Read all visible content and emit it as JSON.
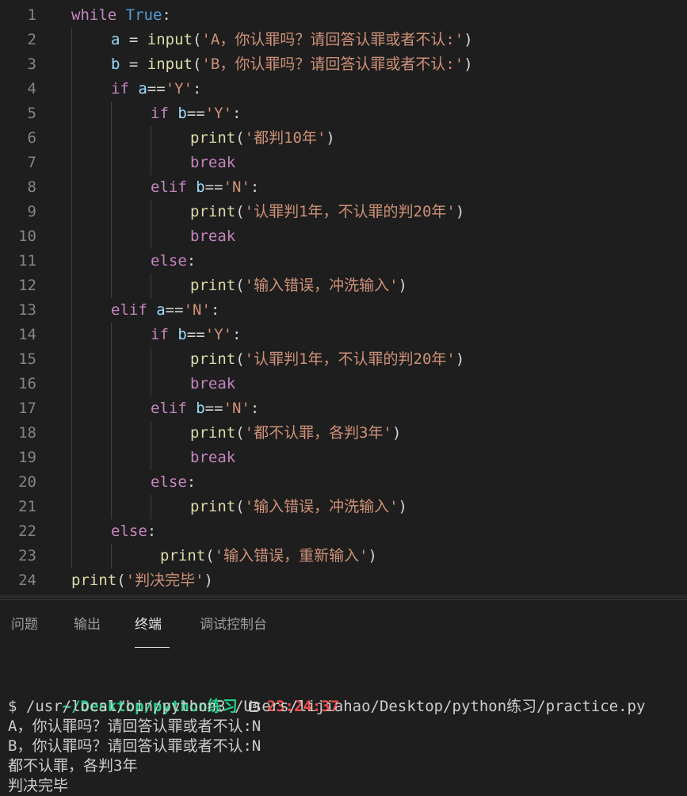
{
  "editor": {
    "lines": [
      {
        "n": "1",
        "tokens": [
          [
            "kw",
            "while"
          ],
          [
            "punc",
            " "
          ],
          [
            "const",
            "True"
          ],
          [
            "punc",
            ":"
          ]
        ]
      },
      {
        "n": "2",
        "tokens": [
          [
            "var",
            "a"
          ],
          [
            "punc",
            " = "
          ],
          [
            "fn",
            "input"
          ],
          [
            "punc",
            "("
          ],
          [
            "str",
            "'A，你认罪吗？请回答认罪或者不认:'"
          ],
          [
            "punc",
            ")"
          ]
        ]
      },
      {
        "n": "3",
        "tokens": [
          [
            "var",
            "b"
          ],
          [
            "punc",
            " = "
          ],
          [
            "fn",
            "input"
          ],
          [
            "punc",
            "("
          ],
          [
            "str",
            "'B，你认罪吗？请回答认罪或者不认:'"
          ],
          [
            "punc",
            ")"
          ]
        ]
      },
      {
        "n": "4",
        "tokens": [
          [
            "kw",
            "if"
          ],
          [
            "punc",
            " "
          ],
          [
            "var",
            "a"
          ],
          [
            "punc",
            "=="
          ],
          [
            "str",
            "'Y'"
          ],
          [
            "punc",
            ":"
          ]
        ]
      },
      {
        "n": "5",
        "tokens": [
          [
            "kw",
            "if"
          ],
          [
            "punc",
            " "
          ],
          [
            "var",
            "b"
          ],
          [
            "punc",
            "=="
          ],
          [
            "str",
            "'Y'"
          ],
          [
            "punc",
            ":"
          ]
        ]
      },
      {
        "n": "6",
        "tokens": [
          [
            "fn",
            "print"
          ],
          [
            "punc",
            "("
          ],
          [
            "str",
            "'都判10年'"
          ],
          [
            "punc",
            ")"
          ]
        ]
      },
      {
        "n": "7",
        "tokens": [
          [
            "kw",
            "break"
          ]
        ]
      },
      {
        "n": "8",
        "tokens": [
          [
            "kw",
            "elif"
          ],
          [
            "punc",
            " "
          ],
          [
            "var",
            "b"
          ],
          [
            "punc",
            "=="
          ],
          [
            "str",
            "'N'"
          ],
          [
            "punc",
            ":"
          ]
        ]
      },
      {
        "n": "9",
        "tokens": [
          [
            "fn",
            "print"
          ],
          [
            "punc",
            "("
          ],
          [
            "str",
            "'认罪判1年，不认罪的判20年'"
          ],
          [
            "punc",
            ")"
          ]
        ]
      },
      {
        "n": "10",
        "tokens": [
          [
            "kw",
            "break"
          ]
        ]
      },
      {
        "n": "11",
        "tokens": [
          [
            "kw",
            "else"
          ],
          [
            "punc",
            ":"
          ]
        ]
      },
      {
        "n": "12",
        "tokens": [
          [
            "fn",
            "print"
          ],
          [
            "punc",
            "("
          ],
          [
            "str",
            "'输入错误，冲洗输入'"
          ],
          [
            "punc",
            ")"
          ]
        ]
      },
      {
        "n": "13",
        "tokens": [
          [
            "kw",
            "elif"
          ],
          [
            "punc",
            " "
          ],
          [
            "var",
            "a"
          ],
          [
            "punc",
            "=="
          ],
          [
            "str",
            "'N'"
          ],
          [
            "punc",
            ":"
          ]
        ]
      },
      {
        "n": "14",
        "tokens": [
          [
            "kw",
            "if"
          ],
          [
            "punc",
            " "
          ],
          [
            "var",
            "b"
          ],
          [
            "punc",
            "=="
          ],
          [
            "str",
            "'Y'"
          ],
          [
            "punc",
            ":"
          ]
        ]
      },
      {
        "n": "15",
        "tokens": [
          [
            "fn",
            "print"
          ],
          [
            "punc",
            "("
          ],
          [
            "str",
            "'认罪判1年，不认罪的判20年'"
          ],
          [
            "punc",
            ")"
          ]
        ]
      },
      {
        "n": "16",
        "tokens": [
          [
            "kw",
            "break"
          ]
        ]
      },
      {
        "n": "17",
        "tokens": [
          [
            "kw",
            "elif"
          ],
          [
            "punc",
            " "
          ],
          [
            "var",
            "b"
          ],
          [
            "punc",
            "=="
          ],
          [
            "str",
            "'N'"
          ],
          [
            "punc",
            ":"
          ]
        ]
      },
      {
        "n": "18",
        "tokens": [
          [
            "fn",
            "print"
          ],
          [
            "punc",
            "("
          ],
          [
            "str",
            "'都不认罪，各判3年'"
          ],
          [
            "punc",
            ")"
          ]
        ]
      },
      {
        "n": "19",
        "tokens": [
          [
            "kw",
            "break"
          ]
        ]
      },
      {
        "n": "20",
        "tokens": [
          [
            "kw",
            "else"
          ],
          [
            "punc",
            ":"
          ]
        ]
      },
      {
        "n": "21",
        "tokens": [
          [
            "fn",
            "print"
          ],
          [
            "punc",
            "("
          ],
          [
            "str",
            "'输入错误，冲洗输入'"
          ],
          [
            "punc",
            ")"
          ]
        ]
      },
      {
        "n": "22",
        "tokens": [
          [
            "kw",
            "else"
          ],
          [
            "punc",
            ":"
          ]
        ]
      },
      {
        "n": "23",
        "tokens": [
          [
            "fn",
            "print"
          ],
          [
            "punc",
            "("
          ],
          [
            "str",
            "'输入错误，重新输入'"
          ],
          [
            "punc",
            ")"
          ]
        ]
      },
      {
        "n": "24",
        "tokens": [
          [
            "fn",
            "print"
          ],
          [
            "punc",
            "("
          ],
          [
            "str",
            "'判决完毕'"
          ],
          [
            "punc",
            ")"
          ]
        ]
      }
    ]
  },
  "panel": {
    "tabs": [
      {
        "label": "问题",
        "active": false
      },
      {
        "label": "输出",
        "active": false
      },
      {
        "label": "终端",
        "active": true
      },
      {
        "label": "调试控制台",
        "active": false
      }
    ]
  },
  "terminal": {
    "prompt_path": "~/Desktop/python练习",
    "clock_icon": "clock-icon",
    "prompt_time": "23:24:37",
    "command": "$ /usr/local/bin/python3 /Users/lijiahao/Desktop/python练习/practice.py",
    "output": [
      "A，你认罪吗？请回答认罪或者不认:N",
      "B，你认罪吗？请回答认罪或者不认:N",
      "都不认罪，各判3年",
      "判决完毕"
    ]
  },
  "colors": {
    "background": "#1e1e1e",
    "keyword": "#c586c0",
    "constant": "#569cd6",
    "variable": "#9cdcfe",
    "function": "#dcdcaa",
    "string": "#ce9178",
    "terminal_path": "#23d18b",
    "terminal_time": "#f14c4c"
  }
}
